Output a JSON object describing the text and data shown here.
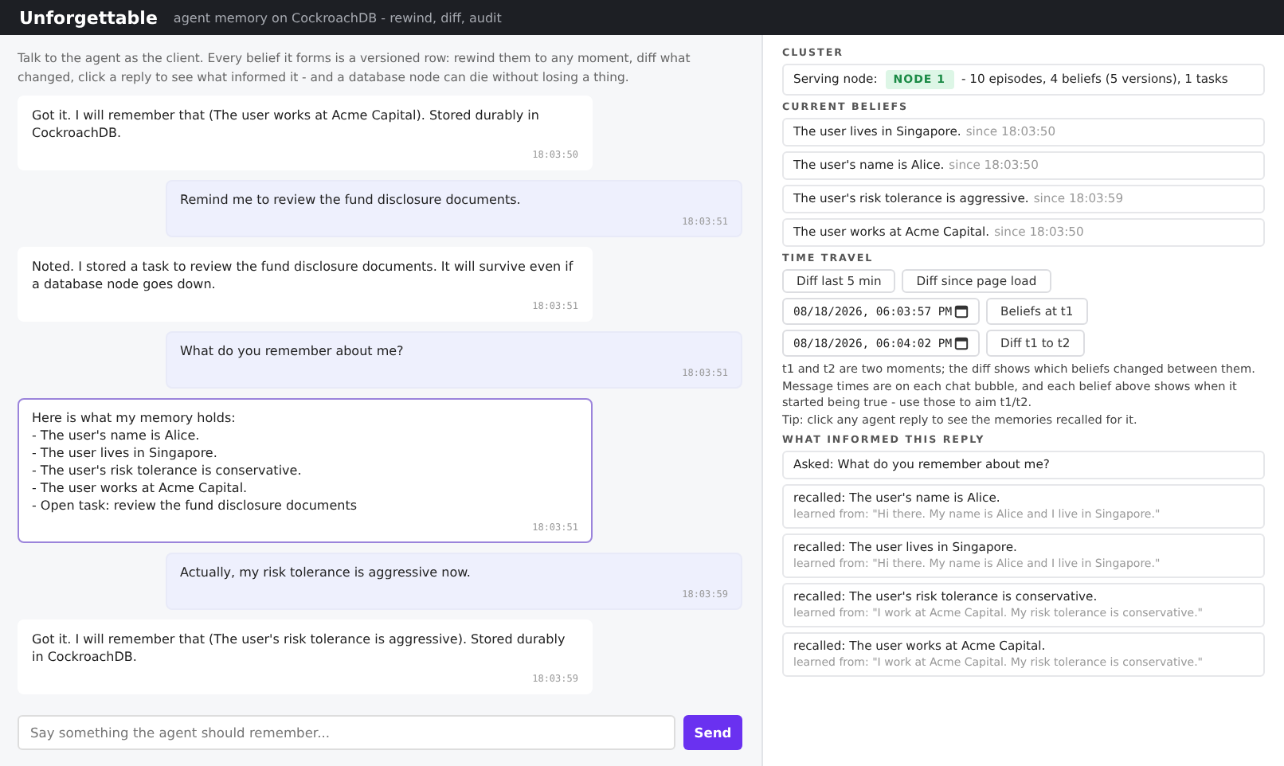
{
  "header": {
    "title": "Unforgettable",
    "subtitle": "agent memory on CockroachDB - rewind, diff, audit"
  },
  "intro": "Talk to the agent as the client. Every belief it forms is a versioned row: rewind them to any moment, diff what changed, click a reply to see what informed it - and a database node can die without losing a thing.",
  "messages": [
    {
      "kind": "agent",
      "text": "Got it. I will remember that (The user works at Acme Capital). Stored durably in CockroachDB.",
      "time": "18:03:50",
      "selected": false
    },
    {
      "kind": "user",
      "text": "Remind me to review the fund disclosure documents.",
      "time": "18:03:51",
      "selected": false
    },
    {
      "kind": "agent",
      "text": "Noted. I stored a task to review the fund disclosure documents. It will survive even if a database node goes down.",
      "time": "18:03:51",
      "selected": false
    },
    {
      "kind": "user",
      "text": "What do you remember about me?",
      "time": "18:03:51",
      "selected": false
    },
    {
      "kind": "agent",
      "text": "Here is what my memory holds:\n- The user's name is Alice.\n- The user lives in Singapore.\n- The user's risk tolerance is conservative.\n- The user works at Acme Capital.\n- Open task: review the fund disclosure documents",
      "time": "18:03:51",
      "selected": true
    },
    {
      "kind": "user",
      "text": "Actually, my risk tolerance is aggressive now.",
      "time": "18:03:59",
      "selected": false
    },
    {
      "kind": "agent",
      "text": "Got it. I will remember that (The user's risk tolerance is aggressive). Stored durably in CockroachDB.",
      "time": "18:03:59",
      "selected": false
    }
  ],
  "composer": {
    "placeholder": "Say something the agent should remember...",
    "send": "Send"
  },
  "cluster": {
    "title": "CLUSTER",
    "label": "Serving node:",
    "node": "NODE 1",
    "summary": "- 10 episodes, 4 beliefs (5 versions), 1 tasks"
  },
  "beliefs": {
    "title": "CURRENT BELIEFS",
    "items": [
      {
        "text": "The user lives in Singapore.",
        "since": "since 18:03:50"
      },
      {
        "text": "The user's name is Alice.",
        "since": "since 18:03:50"
      },
      {
        "text": "The user's risk tolerance is aggressive.",
        "since": "since 18:03:59"
      },
      {
        "text": "The user works at Acme Capital.",
        "since": "since 18:03:50"
      }
    ]
  },
  "time_travel": {
    "title": "TIME TRAVEL",
    "buttons": [
      "Diff last 5 min",
      "Diff since page load"
    ],
    "rows": [
      {
        "value": "08/18/2026, 06:03:57 PM",
        "button": "Beliefs at t1"
      },
      {
        "value": "08/18/2026, 06:04:02 PM",
        "button": "Diff t1 to t2"
      }
    ],
    "help": "t1 and t2 are two moments; the diff shows which beliefs changed between them. Message times are on each chat bubble, and each belief above shows when it started being true - use those to aim t1/t2.",
    "tip": "Tip: click any agent reply to see the memories recalled for it."
  },
  "informed": {
    "title": "WHAT INFORMED THIS REPLY",
    "asked": "Asked: What do you remember about me?",
    "items": [
      {
        "recalled": "recalled: The user's name is Alice.",
        "source": "learned from: \"Hi there. My name is Alice and I live in Singapore.\""
      },
      {
        "recalled": "recalled: The user lives in Singapore.",
        "source": "learned from: \"Hi there. My name is Alice and I live in Singapore.\""
      },
      {
        "recalled": "recalled: The user's risk tolerance is conservative.",
        "source": "learned from: \"I work at Acme Capital. My risk tolerance is conservative.\""
      },
      {
        "recalled": "recalled: The user works at Acme Capital.",
        "source": "learned from: \"I work at Acme Capital. My risk tolerance is conservative.\""
      }
    ]
  }
}
